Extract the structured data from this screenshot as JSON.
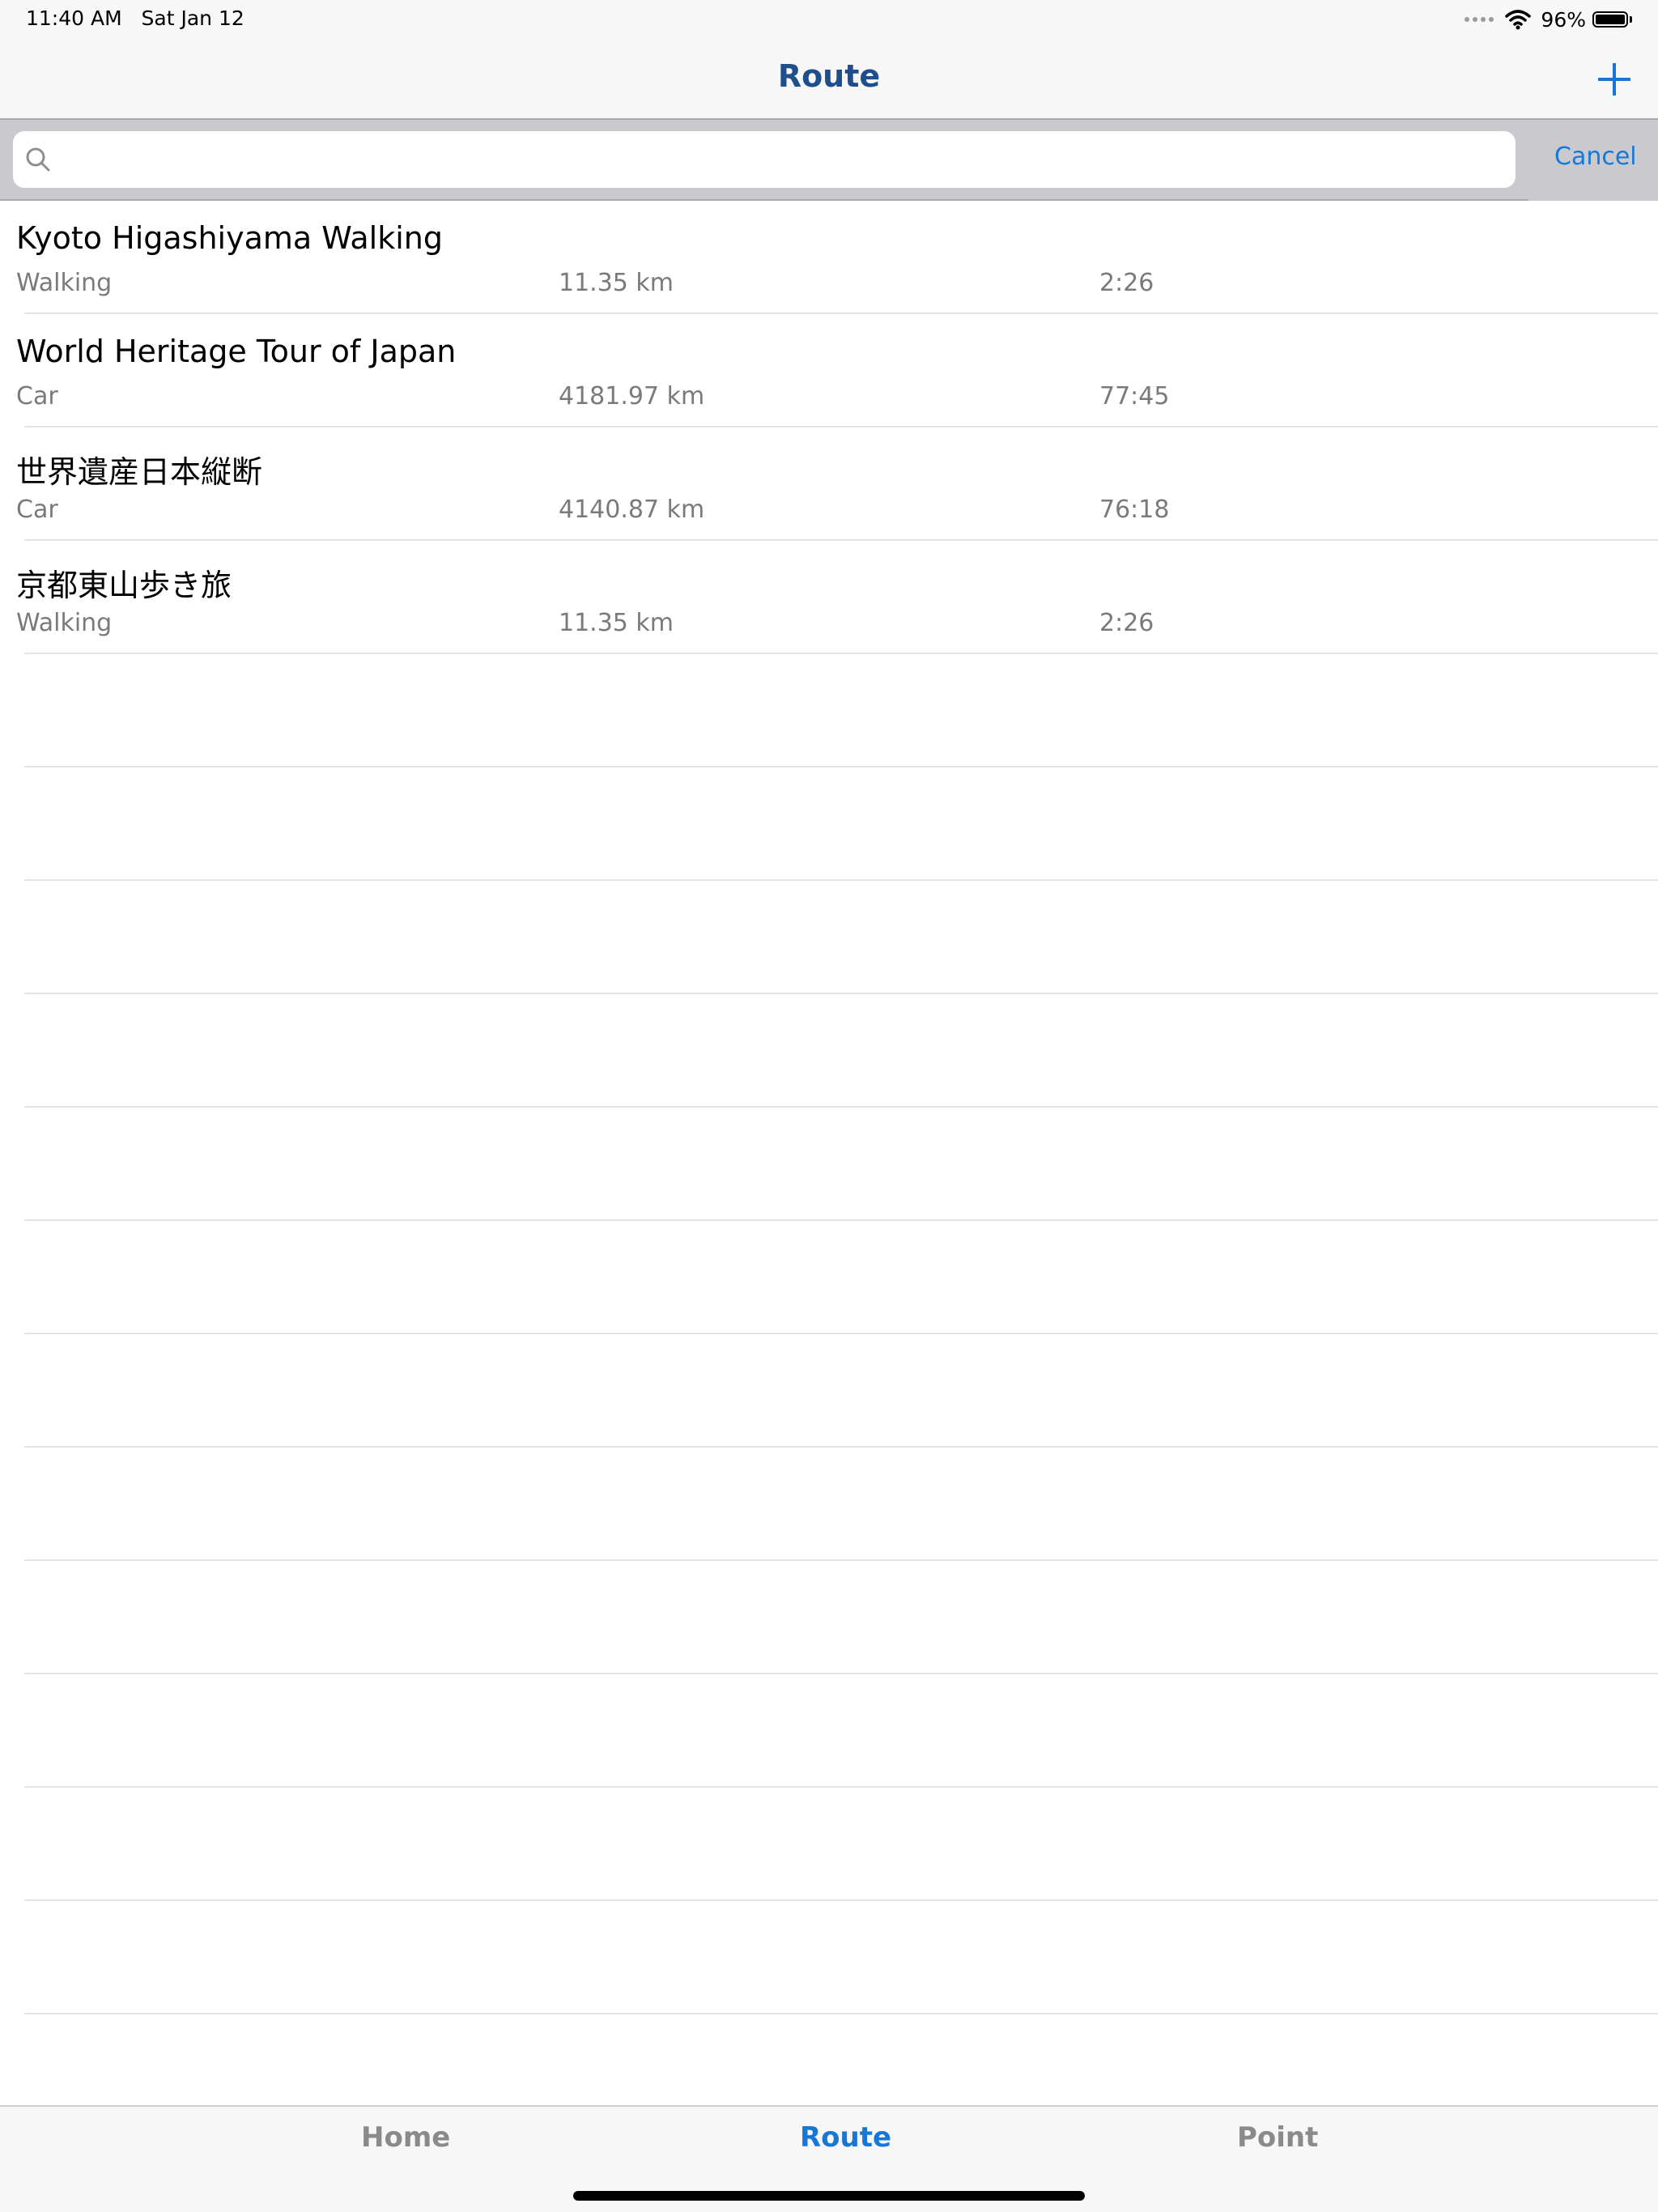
{
  "status_bar": {
    "time": "11:40 AM",
    "date": "Sat Jan 12",
    "battery": "96%",
    "icons": [
      "signal-dots-icon",
      "wifi-icon",
      "battery-icon"
    ]
  },
  "nav": {
    "title": "Route",
    "add_icon": "plus-icon"
  },
  "search": {
    "placeholder": "",
    "value": "",
    "icon": "search-icon",
    "cancel_label": "Cancel"
  },
  "routes": [
    {
      "title": "Kyoto Higashiyama Walking",
      "type": "Walking",
      "distance": "11.35 km",
      "time": "2:26"
    },
    {
      "title": "World Heritage Tour of Japan",
      "type": "Car",
      "distance": "4181.97 km",
      "time": "77:45"
    },
    {
      "title": "世界遺産日本縦断",
      "type": "Car",
      "distance": "4140.87 km",
      "time": "76:18"
    },
    {
      "title": "京都東山歩き旅",
      "type": "Walking",
      "distance": "11.35 km",
      "time": "2:26"
    }
  ],
  "tabs": {
    "home": "Home",
    "route": "Route",
    "point": "Point",
    "active": "Route"
  },
  "colors": {
    "accent": "#1877d6",
    "nav_title": "#1f4e8c",
    "secondary_text": "#7a7a7a",
    "bar_background": "#f7f7f7",
    "search_background": "#c9c9ce"
  }
}
